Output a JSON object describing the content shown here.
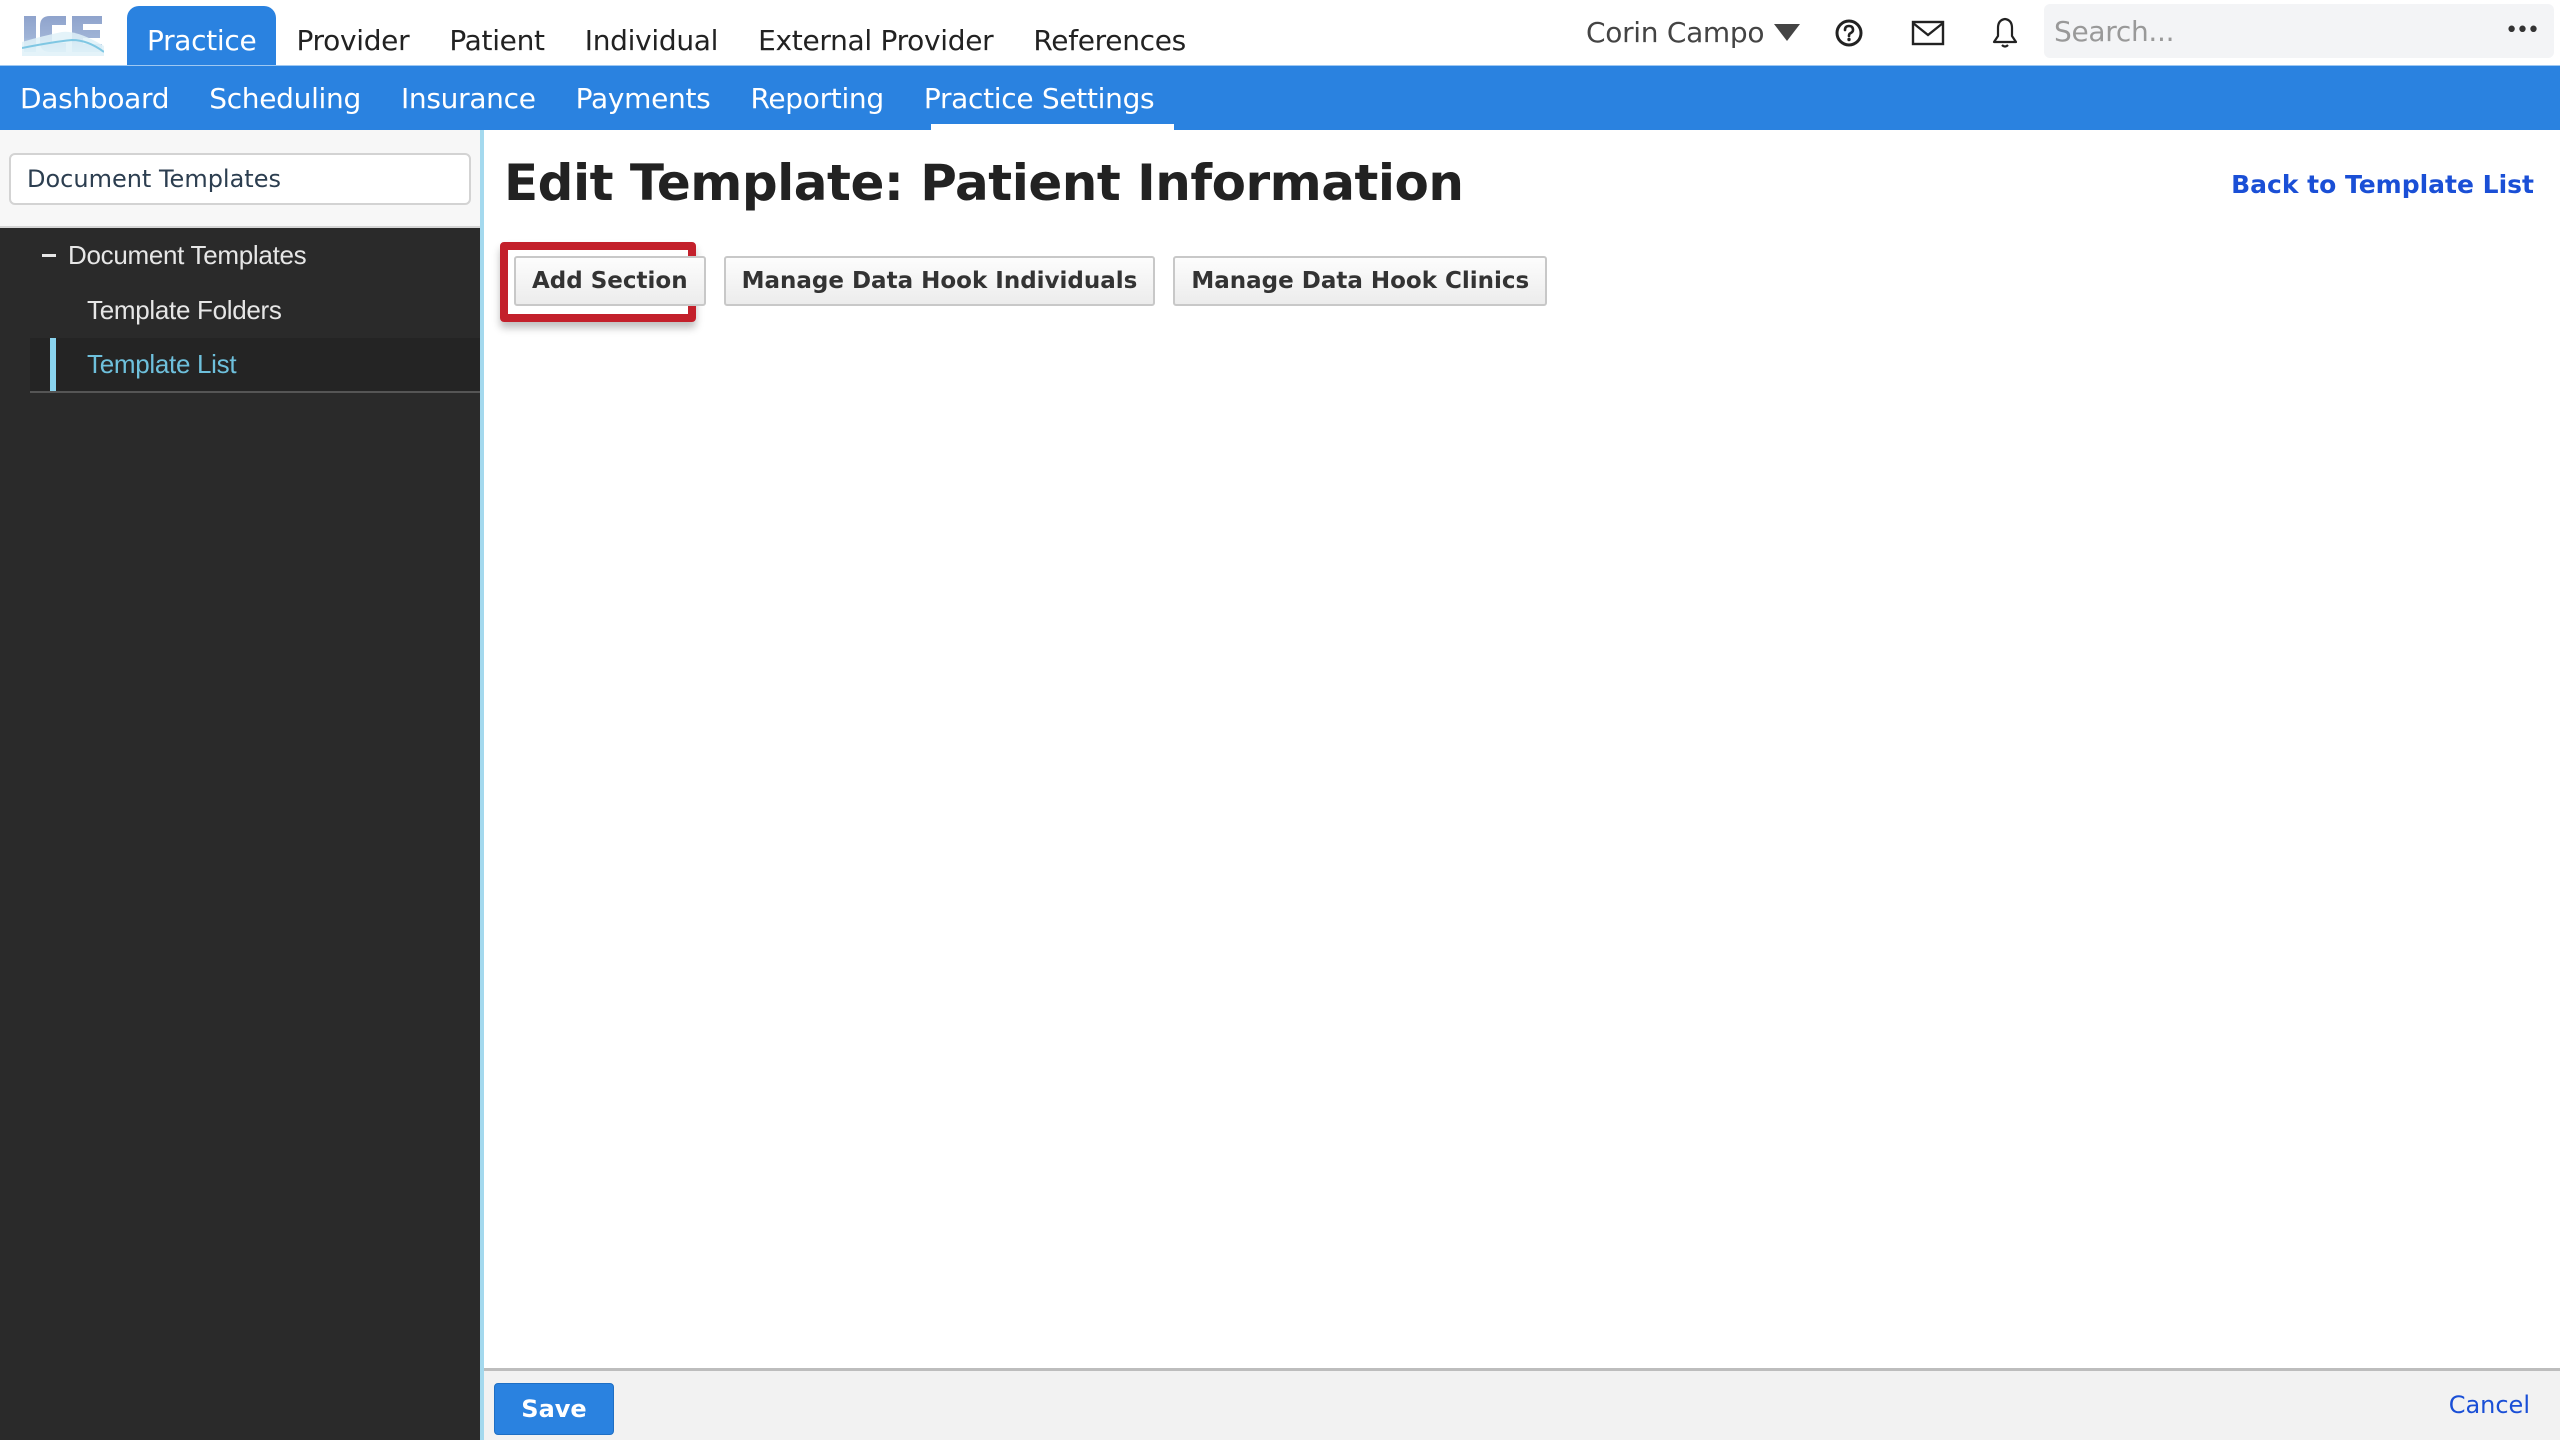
{
  "app": {
    "logo_text": "ICE",
    "main_tabs": [
      {
        "label": "Practice",
        "active": true
      },
      {
        "label": "Provider",
        "active": false
      },
      {
        "label": "Patient",
        "active": false
      },
      {
        "label": "Individual",
        "active": false
      },
      {
        "label": "External Provider",
        "active": false
      },
      {
        "label": "References",
        "active": false
      }
    ],
    "user_name": "Corin Campo",
    "icons": [
      "help-icon",
      "mail-icon",
      "bell-icon"
    ],
    "search": {
      "placeholder": "Search...",
      "value": "",
      "more_label": "•••"
    }
  },
  "subnav": {
    "tabs": [
      {
        "label": "Dashboard",
        "active": false
      },
      {
        "label": "Scheduling",
        "active": false
      },
      {
        "label": "Insurance",
        "active": false
      },
      {
        "label": "Payments",
        "active": false
      },
      {
        "label": "Reporting",
        "active": false
      },
      {
        "label": "Practice Settings",
        "active": true
      }
    ]
  },
  "sidebar": {
    "filter_value": "Document Templates",
    "tree": [
      {
        "label": "Document Templates",
        "level": 0,
        "expanded": true
      },
      {
        "label": "Template Folders",
        "level": 1,
        "active": false
      },
      {
        "label": "Template List",
        "level": 1,
        "active": true
      }
    ]
  },
  "main": {
    "title": "Edit Template: Patient Information",
    "back_link": "Back to Template List",
    "buttons": [
      {
        "label": "Add Section",
        "highlighted": true
      },
      {
        "label": "Manage Data Hook Individuals",
        "highlighted": false
      },
      {
        "label": "Manage Data Hook Clinics",
        "highlighted": false
      }
    ]
  },
  "footer": {
    "save_label": "Save",
    "cancel_label": "Cancel"
  },
  "colors": {
    "brand_blue": "#2a82e0",
    "link_blue": "#1a4fd6",
    "highlight_red": "#c3202b",
    "sidebar_bg": "#2a2a2a",
    "active_accent": "#8ad4ef"
  }
}
